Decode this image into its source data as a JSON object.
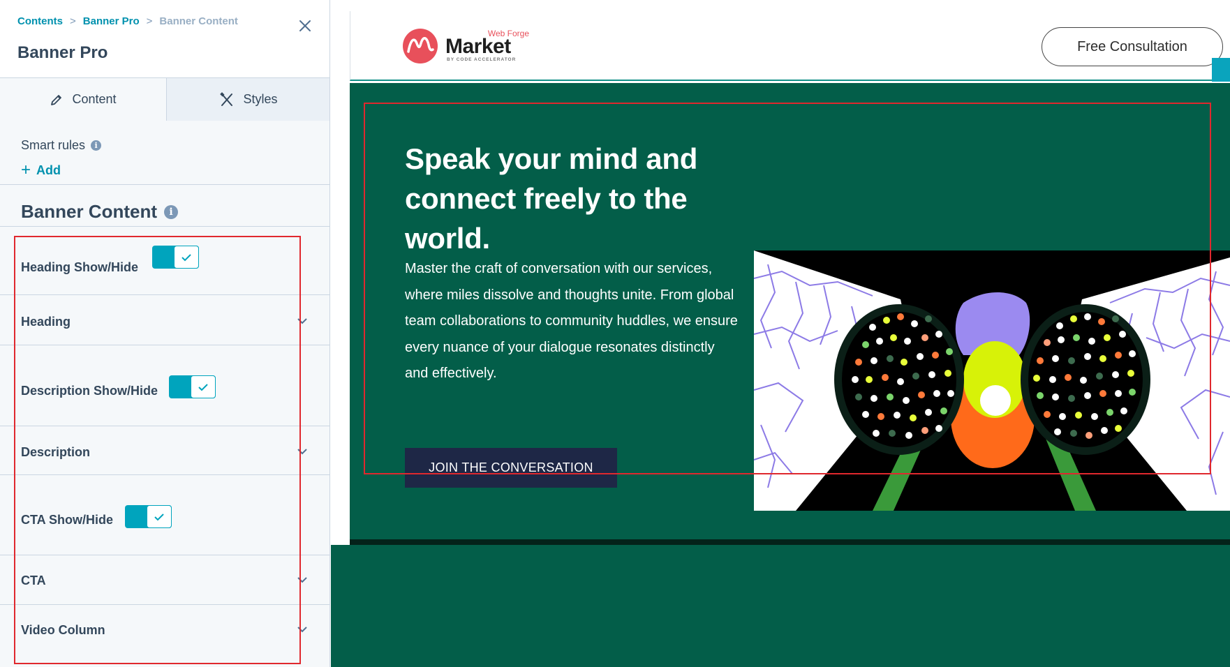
{
  "panel": {
    "breadcrumb": {
      "item1": "Contents",
      "item2": "Banner Pro",
      "item3": "Banner Content",
      "separator": ">"
    },
    "title": "Banner Pro",
    "tabs": {
      "content": "Content",
      "styles": "Styles"
    },
    "smart_rules": {
      "label": "Smart rules",
      "add": "Add"
    },
    "section_title": "Banner Content",
    "fields": {
      "heading_toggle": {
        "label": "Heading Show/Hide",
        "on": true
      },
      "heading": "Heading",
      "description_toggle": {
        "label": "Description Show/Hide",
        "on": true
      },
      "description": "Description",
      "cta_toggle": {
        "label": "CTA Show/Hide",
        "on": true
      },
      "cta": "CTA",
      "video_column": "Video Column"
    },
    "colors": {
      "accent": "#00a4bd",
      "link": "#0091ae",
      "text": "#33475b",
      "highlight": "#e0282e"
    }
  },
  "site": {
    "logo": {
      "superscript": "Web Forge",
      "main": "Market",
      "sub": "BY CODE ACCELERATOR"
    },
    "header_cta": "Free Consultation",
    "hero": {
      "heading": "Speak your mind and connect freely to the world.",
      "description": "Master the craft of conversation with our services, where miles dissolve and thoughts unite. From global team collaborations to community huddles, we ensure every nuance of your dialogue resonates distinctly and effectively.",
      "button": "JOIN THE CONVERSATION"
    },
    "colors": {
      "hero_bg": "#035e49",
      "button_bg": "#1e2746",
      "logo_accent": "#e8505b"
    }
  }
}
